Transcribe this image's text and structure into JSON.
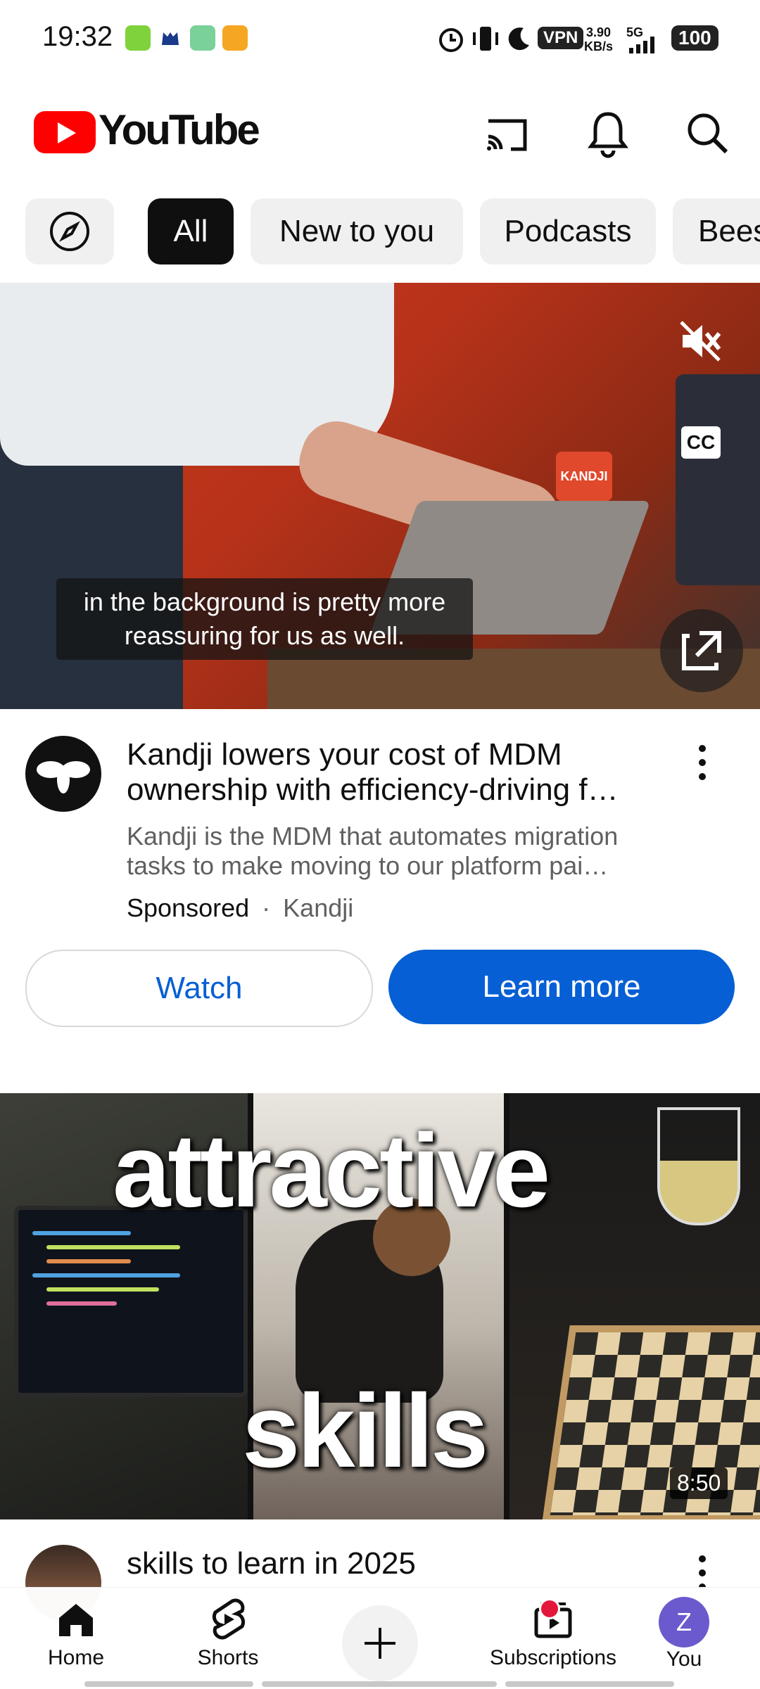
{
  "status_bar": {
    "time": "19:32",
    "vpn": "VPN",
    "speed_top": "3.90",
    "speed_bottom": "KB/s",
    "network": "5G",
    "battery": "100"
  },
  "header": {
    "logo_text": "YouTube",
    "icons": [
      "cast-icon",
      "notifications-icon",
      "search-icon"
    ]
  },
  "chips": [
    {
      "label": ""
    },
    {
      "label": "All"
    },
    {
      "label": "New to you"
    },
    {
      "label": "Podcasts"
    },
    {
      "label": "Bees"
    }
  ],
  "ad": {
    "caption": "in the background is pretty more reassuring for us as well.",
    "cc": "CC",
    "title": "Kandji lowers your cost of MDM ownership with efficiency-driving f…",
    "description": "Kandji is the MDM that automates migration tasks to make moving to our platform pai…",
    "sponsored": "Sponsored",
    "separator": "·",
    "channel": "Kandji",
    "watch_label": "Watch",
    "learn_more_label": "Learn more",
    "mug_text": "KANDJI"
  },
  "video": {
    "overlay_word_1": "attractive",
    "overlay_word_2": "skills",
    "duration": "8:50",
    "title": "skills to learn in 2025"
  },
  "bottom_nav": {
    "home": "Home",
    "shorts": "Shorts",
    "create": "",
    "subscriptions": "Subscriptions",
    "you": "You",
    "you_initial": "Z"
  },
  "colors": {
    "brand_red": "#ff0000",
    "link_blue": "#065fd4",
    "chip_bg": "#f0f0f0"
  }
}
